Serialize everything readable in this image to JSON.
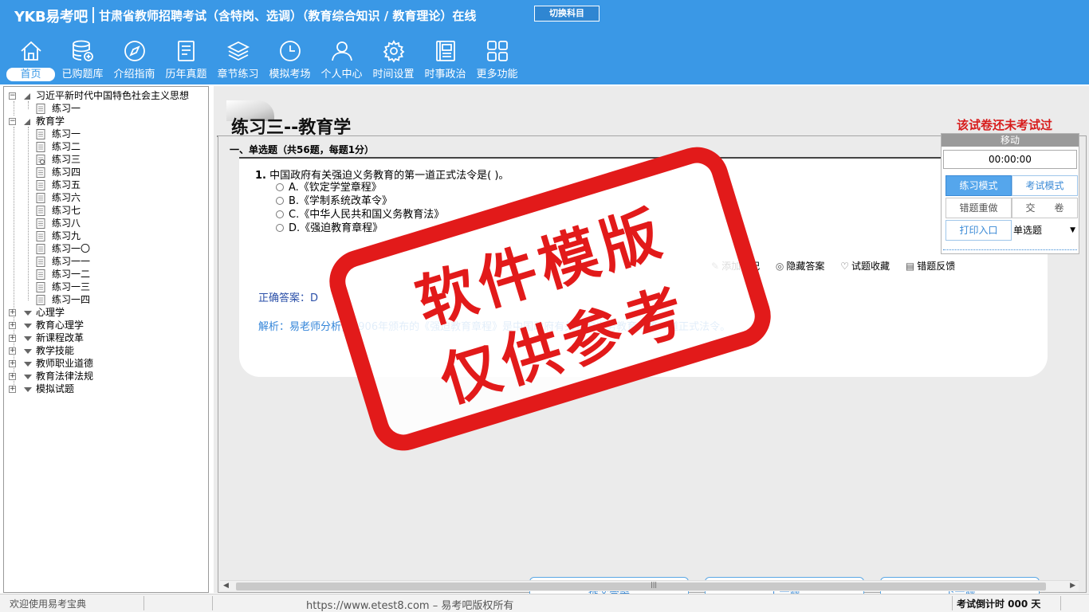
{
  "header": {
    "logo": "YKB易考吧",
    "title": "甘肃省教师招聘考试（含特岗、选调）（教育综合知识 / 教育理论）在线",
    "switch_label": "切换科目"
  },
  "nav": [
    {
      "label": "首页",
      "icon": "home-icon"
    },
    {
      "label": "已购题库",
      "icon": "database-icon"
    },
    {
      "label": "介绍指南",
      "icon": "compass-icon"
    },
    {
      "label": "历年真题",
      "icon": "document-list-icon"
    },
    {
      "label": "章节练习",
      "icon": "layers-icon"
    },
    {
      "label": "模拟考场",
      "icon": "clock-icon"
    },
    {
      "label": "个人中心",
      "icon": "user-icon"
    },
    {
      "label": "时间设置",
      "icon": "gear-icon"
    },
    {
      "label": "时事政治",
      "icon": "newspaper-icon"
    },
    {
      "label": "更多功能",
      "icon": "grid-icon"
    }
  ],
  "tree": {
    "group1": {
      "label": "习近平新时代中国特色社会主义思想",
      "items": [
        "练习一"
      ]
    },
    "group2": {
      "label": "教育学",
      "items": [
        "练习一",
        "练习二",
        "练习三",
        "练习四",
        "练习五",
        "练习六",
        "练习七",
        "练习八",
        "练习九",
        "练习一〇",
        "练习一一",
        "练习一二",
        "练习一三",
        "练习一四"
      ]
    },
    "collapsed": [
      "心理学",
      "教育心理学",
      "新课程改革",
      "教学技能",
      "教师职业道德",
      "教育法律法规",
      "模拟试题"
    ]
  },
  "paper": {
    "title": "练习三--教育学",
    "status": "该试卷还未考试过",
    "section": "一、单选题（共56题，每题1分）"
  },
  "question": {
    "number": "1.",
    "text": "中国政府有关强迫义务教育的第一道正式法令是( )。",
    "options": [
      "A.《钦定学堂章程》",
      "B.《学制系统改革令》",
      "C.《中华人民共和国义务教育法》",
      "D.《强迫教育章程》"
    ],
    "tools": [
      "添加笔记",
      "隐藏答案",
      "试题收藏",
      "错题反馈"
    ],
    "answer": "正确答案：D",
    "analysis": "解析：易老师分析，1906年颁布的《强迫教育章程》是中国政府有关强迫义务教育的第一道正式法令。"
  },
  "buttons": {
    "submit": "提交答案",
    "prev": "上一题",
    "next": "下一题"
  },
  "control": {
    "move": "移动",
    "timer": "00:00:00",
    "practice_mode": "练习模式",
    "exam_mode": "考试模式",
    "redo_wrong": "错题重做",
    "hand_in": "交　　卷",
    "print": "打印入口",
    "type_select": "单选题"
  },
  "watermark": {
    "line1": "软件模版",
    "line2": "仅供参考"
  },
  "statusbar": {
    "welcome": "欢迎使用易考宝典",
    "site": "https://www.etest8.com – 易考吧版权所有",
    "countdown": "考试倒计时 000 天"
  },
  "colors": {
    "brand": "#3a98e6",
    "alert": "#d71c1c",
    "stamp": "#e21a1a"
  }
}
